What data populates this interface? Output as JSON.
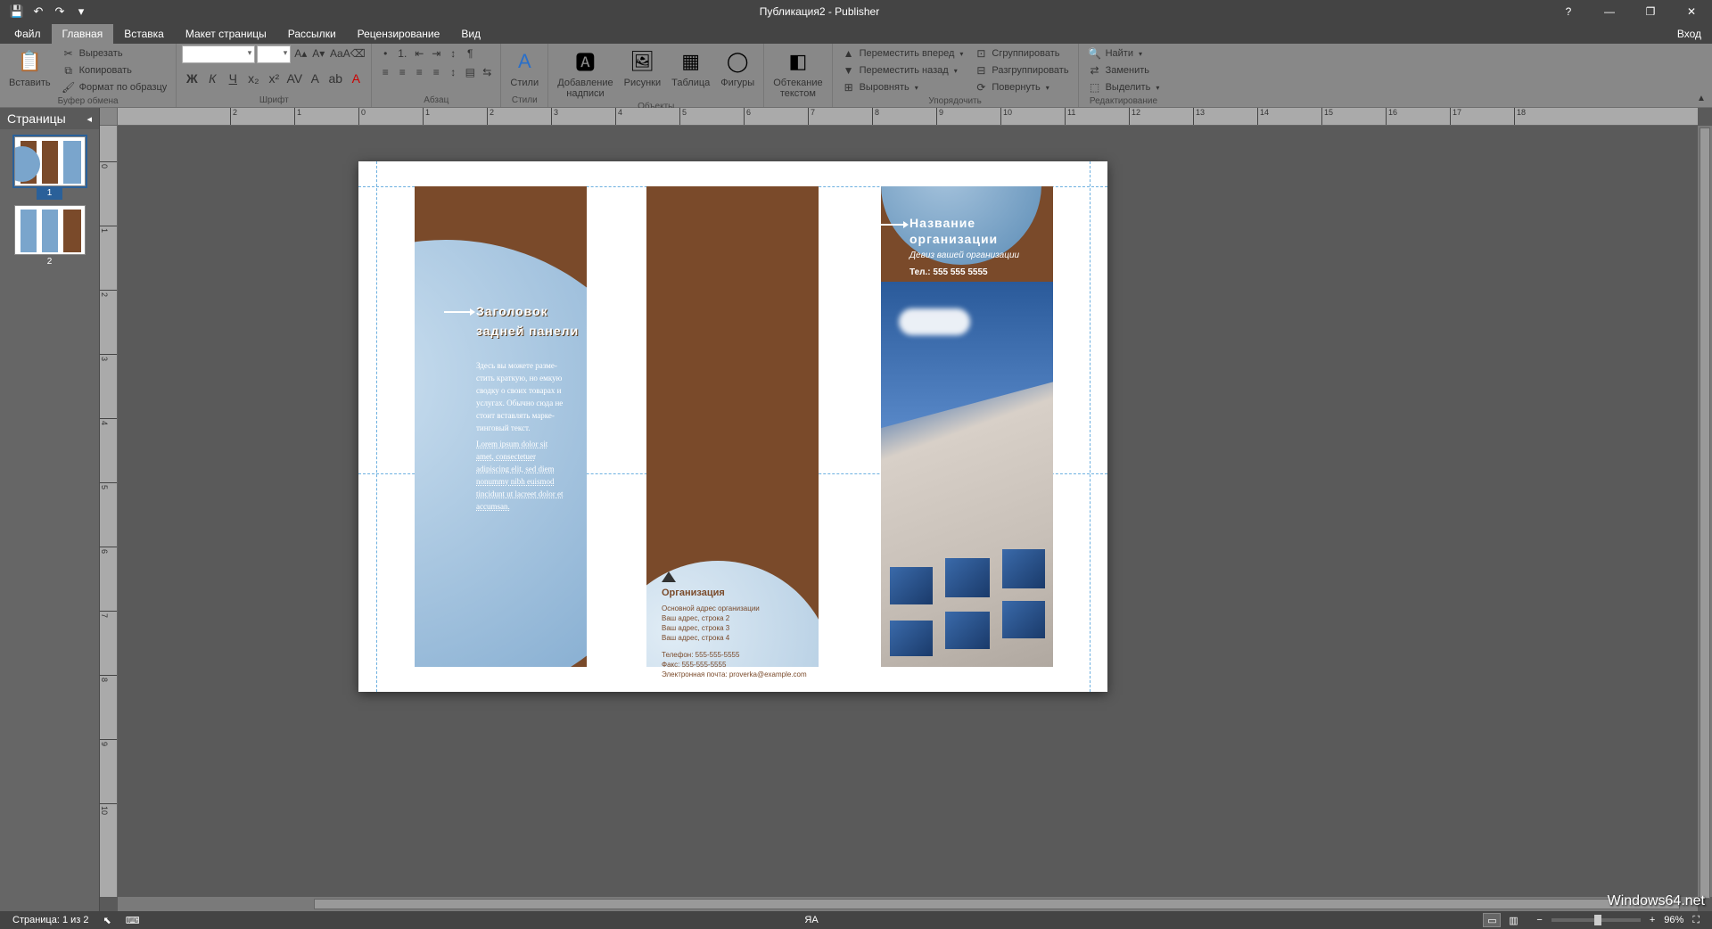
{
  "title": "Публикация2 - Publisher",
  "qat": {
    "save": "💾",
    "undo": "↶",
    "redo": "↷",
    "custom": "▾"
  },
  "window": {
    "help": "?",
    "min": "—",
    "max": "❐",
    "close": "✕"
  },
  "tabs": {
    "file": "Файл",
    "home": "Главная",
    "insert": "Вставка",
    "page_layout": "Макет страницы",
    "mailings": "Рассылки",
    "review": "Рецензирование",
    "view": "Вид",
    "login": "Вход"
  },
  "ribbon": {
    "clipboard": {
      "label": "Буфер обмена",
      "paste": "Вставить",
      "cut": "Вырезать",
      "copy": "Копировать",
      "format_painter": "Формат по образцу"
    },
    "font": {
      "label": "Шрифт",
      "name": "",
      "size": "",
      "bold": "Ж",
      "italic": "К",
      "underline": "Ч",
      "sub": "x₂",
      "sup": "x²",
      "char_spacing": "AV",
      "grow": "A▴",
      "shrink": "A▾",
      "case": "Aa",
      "clear": "A⌫",
      "styles": "A",
      "highlight": "ab",
      "fontcolor": "A"
    },
    "paragraph": {
      "label": "Абзац",
      "bullets": "•",
      "numbers": "1.",
      "outdent": "⇤",
      "indent": "⇥",
      "sort": "↕",
      "pilcrow": "¶",
      "left": "≡",
      "center": "≡",
      "right": "≡",
      "justify": "≡",
      "line_spacing": "↕",
      "columns": "▤",
      "direction": "⇆"
    },
    "styles": {
      "label": "Стили",
      "styles_btn": "Стили"
    },
    "objects": {
      "label": "Объекты",
      "textbox": "Добавление\nнадписи",
      "pictures": "Рисунки",
      "table": "Таблица",
      "shapes": "Фигуры"
    },
    "wrap": {
      "label": " ",
      "btn": "Обтекание\nтекстом"
    },
    "arrange": {
      "label": "Упорядочить",
      "forward": "Переместить вперед",
      "backward": "Переместить назад",
      "align": "Выровнять",
      "group": "Сгруппировать",
      "ungroup": "Разгруппировать",
      "rotate": "Повернуть"
    },
    "editing": {
      "label": "Редактирование",
      "find": "Найти",
      "replace": "Заменить",
      "select": "Выделить"
    }
  },
  "pages_panel": {
    "title": "Страницы",
    "page1": "1",
    "page2": "2"
  },
  "brochure": {
    "panel1": {
      "heading": "Заголовок задней пане­ли",
      "body": "Здесь вы можете разме­стить краткую, но емкую сводку о своих товарах и услугах. Обычно сюда не стоит вставлять марке­тинговый текст.",
      "lorem": "Lorem ipsum dolor sit amet, consectetuer adipiscing elit, sed diem nonummy nibh euismod tincidunt ut lacreet dolor et accumsan."
    },
    "panel2": {
      "org_name": "Организация",
      "addr1": "Основной адрес организации",
      "addr2": "Ваш адрес, строка 2",
      "addr3": "Ваш адрес, строка 3",
      "addr4": "Ваш адрес, строка 4",
      "tel": "Телефон: 555-555-5555",
      "fax": "Факс: 555-555-5555",
      "email": "Электронная почта: proverka@example.com"
    },
    "panel3": {
      "title": "Название организации",
      "motto": "Девиз вашей организации",
      "phone": "Тел.: 555 555 5555"
    }
  },
  "status": {
    "page": "Страница: 1 из 2",
    "lang_indicator": "ЯА",
    "zoom": "96%",
    "zoom_minus": "−",
    "zoom_plus": "+"
  },
  "watermark": "Windows64.net"
}
